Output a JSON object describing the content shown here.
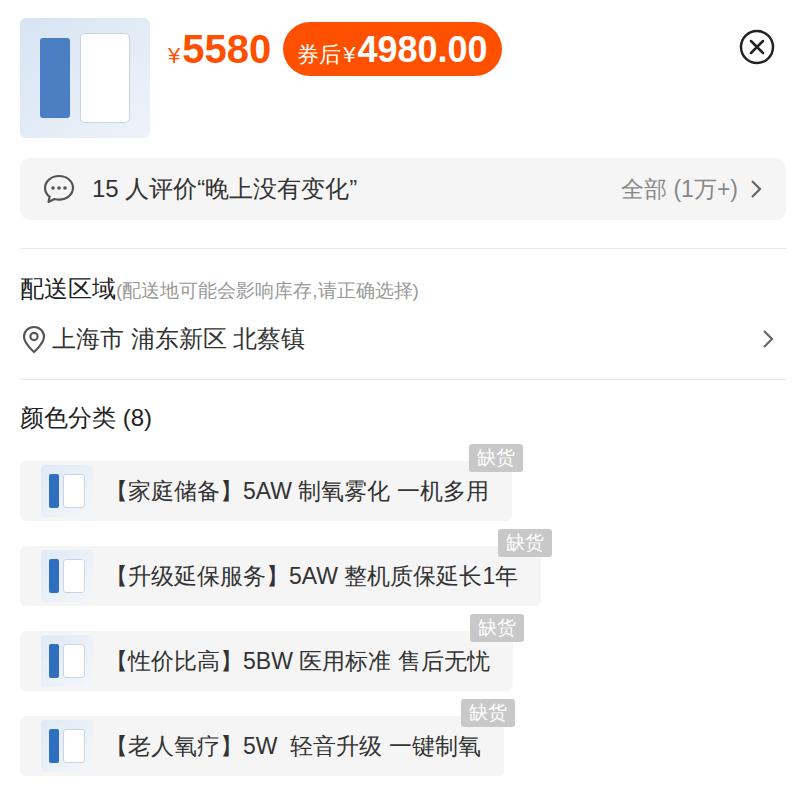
{
  "header": {
    "price_symbol": "¥",
    "price": "5580",
    "coupon_label": "券后",
    "coupon_symbol": "¥",
    "coupon_price": "4980.00"
  },
  "review": {
    "text": "15 人评价“晚上没有变化”",
    "all": "全部 (1万+)"
  },
  "delivery": {
    "label": "配送区域",
    "hint": "(配送地可能会影响库存,请正确选择)",
    "location": "上海市 浦东新区 北蔡镇"
  },
  "options": {
    "title": "颜色分类 (8)",
    "items": [
      {
        "label": "【家庭储备】5AW 制氧雾化 一机多用",
        "badge": "缺货",
        "selected": false
      },
      {
        "label": "【升级延保服务】5AW 整机质保延长1年",
        "badge": "缺货",
        "selected": false
      },
      {
        "label": "【性价比高】5BW 医用标准 售后无忧",
        "badge": "缺货",
        "selected": false
      },
      {
        "label": "【老人氧疗】5W  轻音升级 一键制氧",
        "badge": "缺货",
        "selected": false
      }
    ]
  }
}
